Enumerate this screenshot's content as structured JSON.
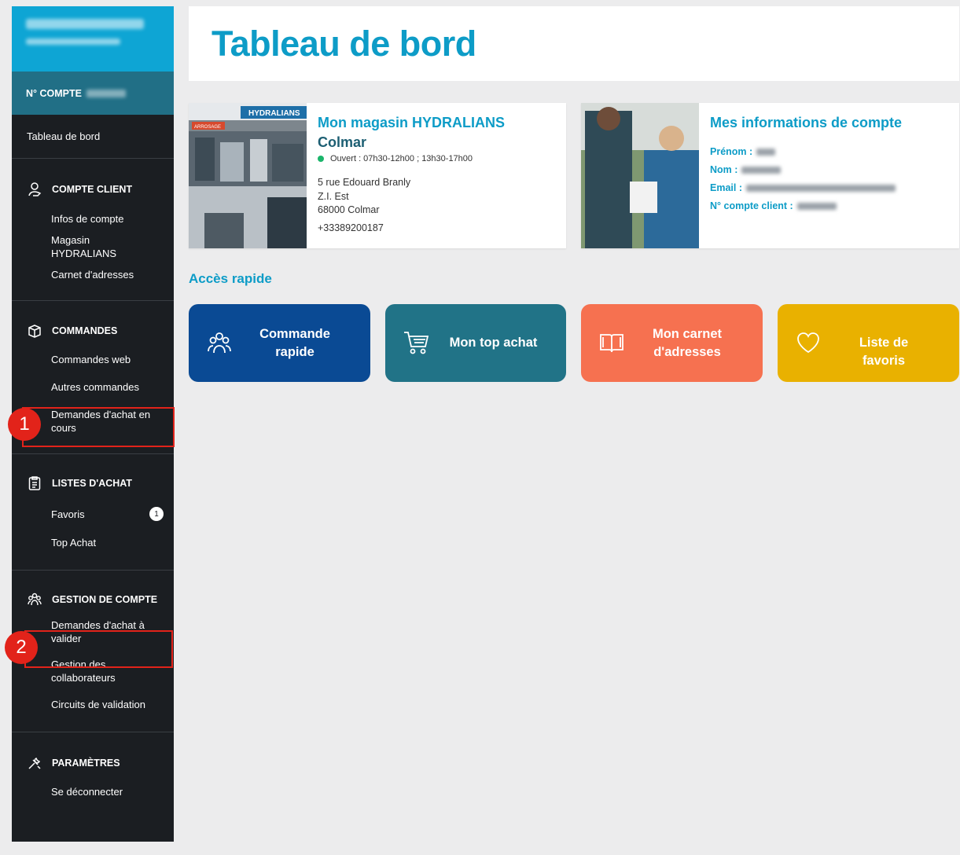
{
  "sidebar": {
    "account_label": "N° COMPTE",
    "dashboard_label": "Tableau de bord",
    "sections": [
      {
        "title": "COMPTE CLIENT",
        "icon": "user-hand-icon",
        "items": [
          "Infos de compte",
          "Magasin HYDRALIANS",
          "Carnet d'adresses"
        ]
      },
      {
        "title": "COMMANDES",
        "icon": "box-icon",
        "items": [
          "Commandes web",
          "Autres commandes",
          "Demandes d'achat en cours"
        ]
      },
      {
        "title": "LISTES D'ACHAT",
        "icon": "clipboard-list-icon",
        "items": [
          "Favoris",
          "Top Achat"
        ],
        "favoris_badge": "1"
      },
      {
        "title": "GESTION DE COMPTE",
        "icon": "team-icon",
        "items": [
          "Demandes d'achat à valider",
          "Gestion des collaborateurs",
          "Circuits de validation"
        ]
      },
      {
        "title": "PARAMÈTRES",
        "icon": "tools-icon",
        "items": [
          "Se déconnecter"
        ]
      }
    ]
  },
  "annotations": {
    "one": "1",
    "two": "2"
  },
  "main": {
    "title": "Tableau de bord",
    "store_card": {
      "title_line1": "Mon magasin HYDRALIANS",
      "title_line2": "Colmar",
      "hours": "Ouvert : 07h30-12h00 ; 13h30-17h00",
      "address": [
        "5 rue Edouard Branly",
        "Z.I. Est",
        "68000 Colmar"
      ],
      "phone": "+33389200187",
      "photo_sign": "HYDRALIANS",
      "photo_sign_small": "ARROSAGE"
    },
    "account_card": {
      "title": "Mes informations de compte",
      "firstname_label": "Prénom :",
      "lastname_label": "Nom :",
      "email_label": "Email :",
      "account_number_label": "N° compte client :"
    },
    "quick_access": {
      "title": "Accès rapide",
      "tiles": [
        {
          "label_1": "Commande",
          "label_2": "rapide",
          "icon": "team-icon",
          "color": "#0a4a94"
        },
        {
          "label_1": "Mon top achat",
          "icon": "cart-icon",
          "color": "#217387"
        },
        {
          "label_1": "Mon carnet",
          "label_2": "d'adresses",
          "icon": "book-icon",
          "color": "#f67150"
        },
        {
          "label_1": "Liste de favoris",
          "icon": "heart-icon",
          "color": "#e9b100"
        }
      ]
    }
  }
}
